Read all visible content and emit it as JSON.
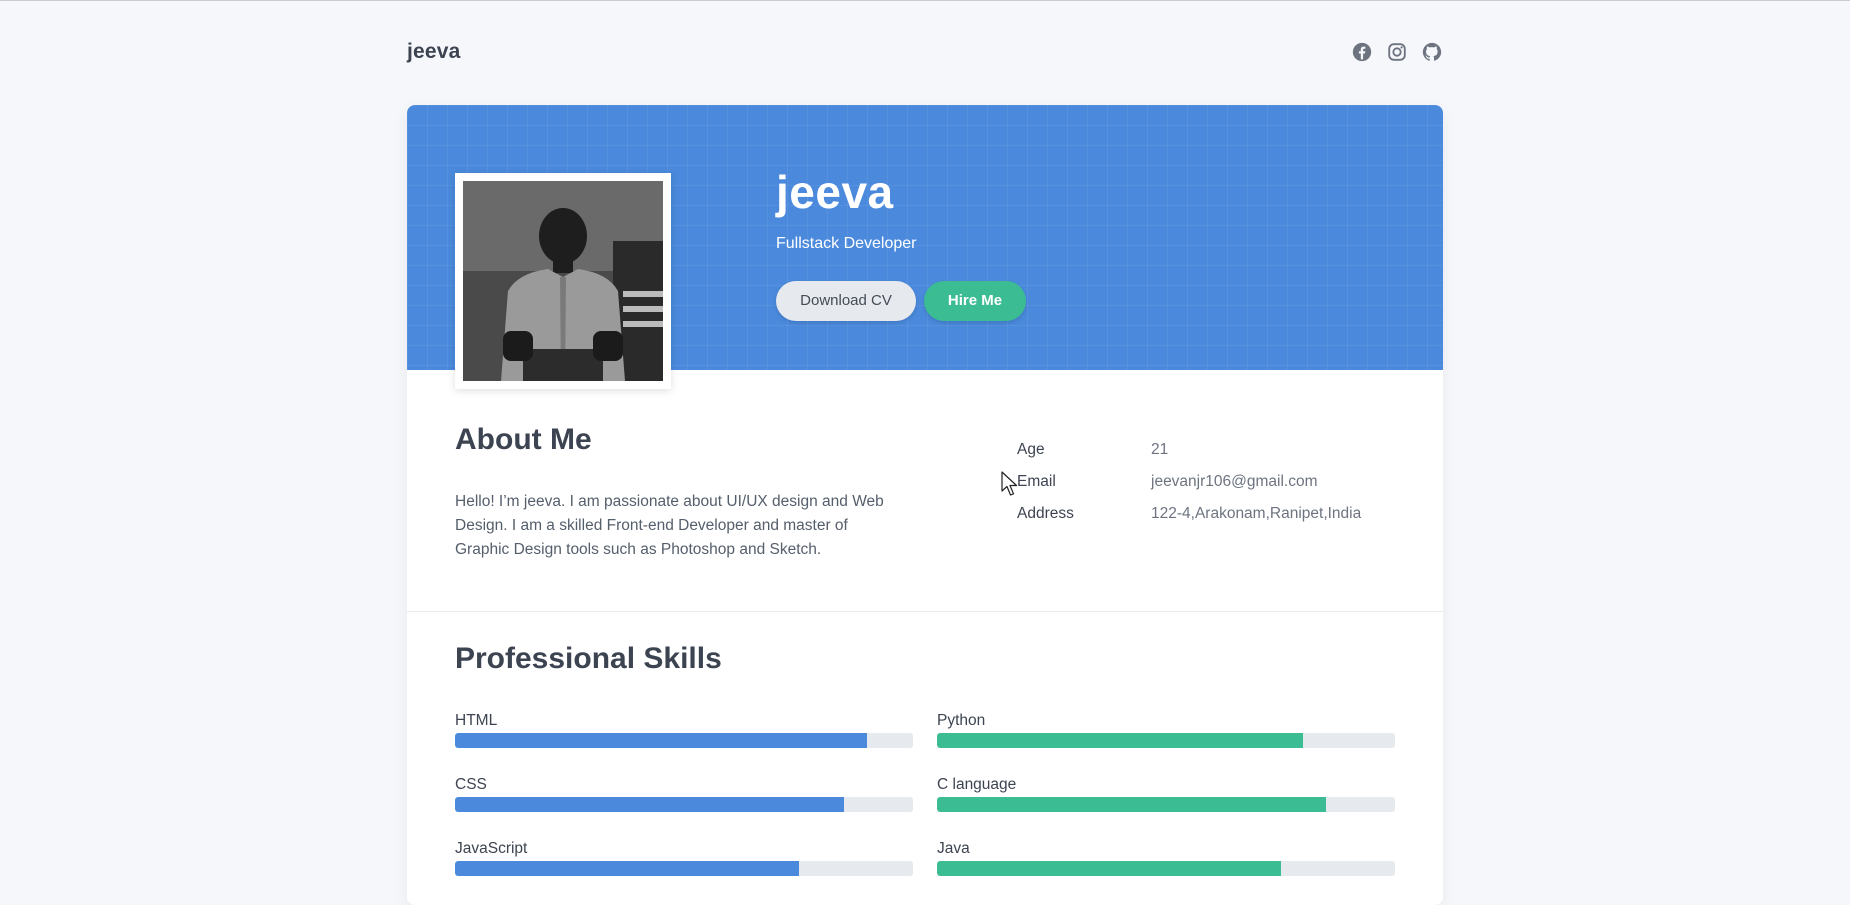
{
  "nav": {
    "brand": "jeeva",
    "socials": [
      {
        "name": "facebook-icon"
      },
      {
        "name": "instagram-icon"
      },
      {
        "name": "github-icon"
      }
    ]
  },
  "hero": {
    "name": "jeeva",
    "role": "Fullstack Developer",
    "download_cv_label": "Download CV",
    "hire_me_label": "Hire Me"
  },
  "about": {
    "title": "About Me",
    "text": "Hello! I’m jeeva. I am passionate about UI/UX design and Web Design. I am a skilled Front-end Developer and master of Graphic Design tools such as Photoshop and Sketch.",
    "info": [
      {
        "label": "Age",
        "value": "21"
      },
      {
        "label": "Email",
        "value": "jeevanjr106@gmail.com"
      },
      {
        "label": "Address",
        "value": "122-4,Arakonam,Ranipet,India"
      }
    ]
  },
  "skills": {
    "title": "Professional Skills",
    "left": [
      {
        "name": "HTML",
        "level": 90
      },
      {
        "name": "CSS",
        "level": 85
      },
      {
        "name": "JavaScript",
        "level": 75
      }
    ],
    "right": [
      {
        "name": "Python",
        "level": 80
      },
      {
        "name": "C language",
        "level": 85
      },
      {
        "name": "Java",
        "level": 75
      }
    ]
  },
  "colors": {
    "primary": "#4a89dc",
    "accent": "#3bbc93",
    "track": "#e6e9ed",
    "text": "#3d4451"
  }
}
